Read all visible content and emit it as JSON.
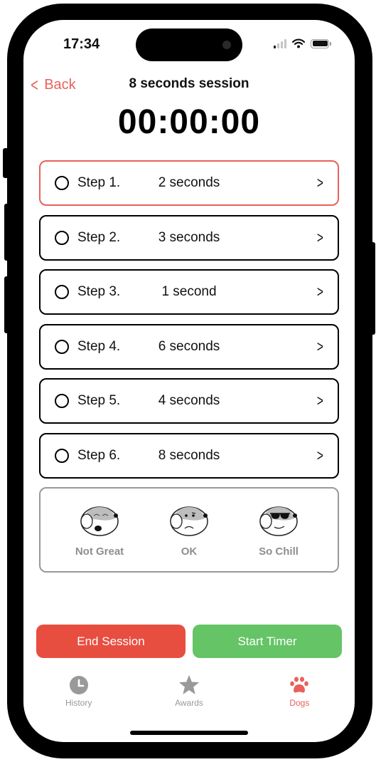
{
  "status_bar": {
    "time": "17:34"
  },
  "nav": {
    "back_label": "Back",
    "title": "8 seconds session"
  },
  "timer": {
    "display": "00:00:00"
  },
  "steps": [
    {
      "label": "Step 1.",
      "duration": "2 seconds",
      "active": true
    },
    {
      "label": "Step 2.",
      "duration": "3 seconds",
      "active": false
    },
    {
      "label": "Step 3.",
      "duration": "1 second",
      "active": false
    },
    {
      "label": "Step 4.",
      "duration": "6 seconds",
      "active": false
    },
    {
      "label": "Step 5.",
      "duration": "4 seconds",
      "active": false
    },
    {
      "label": "Step 6.",
      "duration": "8 seconds",
      "active": false
    }
  ],
  "mood": {
    "options": [
      {
        "label": "Not Great",
        "icon": "dog-crying-icon"
      },
      {
        "label": "OK",
        "icon": "dog-frown-icon"
      },
      {
        "label": "So Chill",
        "icon": "dog-sunglasses-icon"
      }
    ]
  },
  "actions": {
    "end_label": "End Session",
    "start_label": "Start Timer"
  },
  "tabs": [
    {
      "label": "History",
      "icon": "clock-icon",
      "active": false
    },
    {
      "label": "Awards",
      "icon": "star-icon",
      "active": false
    },
    {
      "label": "Dogs",
      "icon": "paw-icon",
      "active": true
    }
  ],
  "colors": {
    "accent": "#e8615a",
    "end": "#e84e40",
    "start": "#65c466",
    "inactive": "#999999"
  }
}
